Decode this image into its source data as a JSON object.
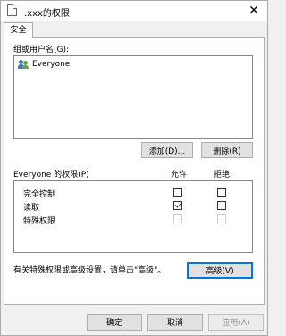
{
  "window": {
    "title": ".xxx的权限",
    "close_icon": "close-icon"
  },
  "tabs": [
    {
      "label": "安全",
      "active": true
    }
  ],
  "groups": {
    "label": "组或用户名(G):",
    "items": [
      {
        "name": "Everyone",
        "icon": "users-icon"
      }
    ]
  },
  "group_buttons": {
    "add": "添加(D)...",
    "remove": "删除(R)"
  },
  "permissions": {
    "header_label": "Everyone 的权限(P)",
    "allow_header": "允许",
    "deny_header": "拒绝",
    "rows": [
      {
        "name": "完全控制",
        "allow": false,
        "deny": false,
        "enabled": true
      },
      {
        "name": "读取",
        "allow": true,
        "deny": false,
        "enabled": true
      },
      {
        "name": "特殊权限",
        "allow": false,
        "deny": false,
        "enabled": false
      }
    ]
  },
  "advanced": {
    "hint": "有关特殊权限或高级设置，请单击\"高级\"。",
    "button": "高级(V)"
  },
  "footer": {
    "ok": "确定",
    "cancel": "取消",
    "apply": "应用(A)"
  }
}
